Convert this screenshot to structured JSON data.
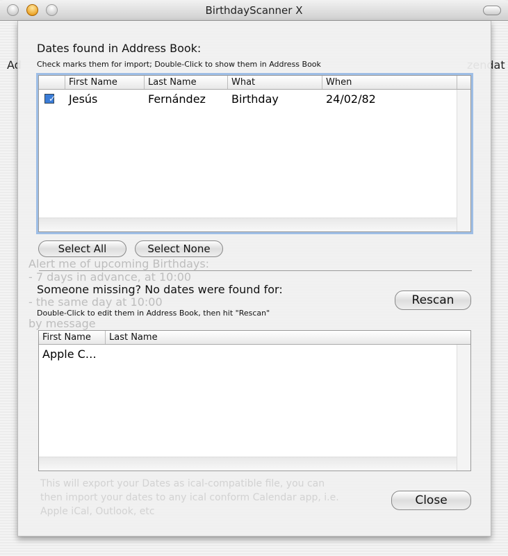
{
  "window": {
    "title": "BirthdayScanner X"
  },
  "background": {
    "left_label": "Ad",
    "right_label": "zendat",
    "alarm_heading": "Alert me of upcoming Birthdays:",
    "alarm_line1": "- 7 days in advance, at 10:00",
    "alarm_line2": "- the same day at 10:00",
    "alarm_line3": "by message",
    "export_text_1": "This will export your Dates as ical-compatible file, you can",
    "export_text_2": "then import your dates to any ical conform Calendar app, i.e.",
    "export_text_3": "Apple iCal, Outlook, etc"
  },
  "found": {
    "heading": "Dates found in Address Book:",
    "hint": "Check marks them for import; Double-Click to show them in Address Book",
    "columns": [
      "First Name",
      "Last Name",
      "What",
      "When"
    ],
    "rows": [
      {
        "checked": true,
        "first": "Jesús",
        "last": "Fernández",
        "what": "Birthday",
        "when": "24/02/82"
      }
    ],
    "select_all": "Select All",
    "select_none": "Select None"
  },
  "missing": {
    "heading": "Someone missing? No dates were found for:",
    "hint": "Double-Click to edit them in Address Book, then hit \"Rescan\"",
    "rescan": "Rescan",
    "columns": [
      "First Name",
      "Last Name"
    ],
    "rows": [
      {
        "first": "Apple C…",
        "last": ""
      }
    ]
  },
  "close": "Close"
}
